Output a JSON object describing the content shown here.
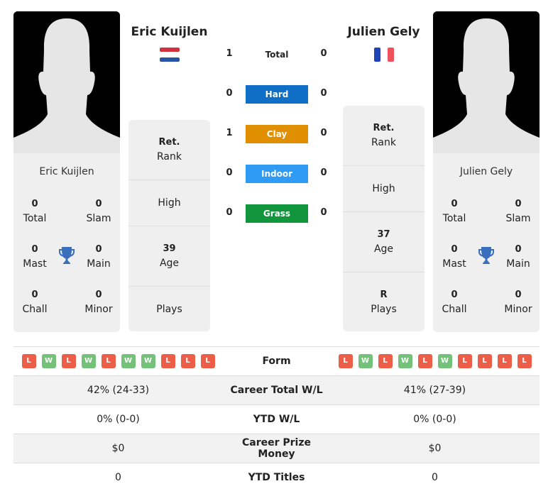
{
  "colors": {
    "hard": "#0f6fc6",
    "clay": "#e08f00",
    "indoor": "#2f9bf5",
    "grass": "#11963d",
    "loss": "#ec5e48",
    "win": "#74c27a",
    "trophy": "#3a6fbd"
  },
  "player1": {
    "name": "Eric Kuijlen",
    "flag": "netherlands-flag",
    "titles": {
      "total": "0",
      "total_label": "Total",
      "slam": "0",
      "slam_label": "Slam",
      "mast": "0",
      "mast_label": "Mast",
      "main": "0",
      "main_label": "Main",
      "chall": "0",
      "chall_label": "Chall",
      "minor": "0",
      "minor_label": "Minor"
    },
    "rank_value": "Ret.",
    "rank_label": "Rank",
    "high_label": "High",
    "age_value": "39",
    "age_label": "Age",
    "plays_value": "",
    "plays_label": "Plays",
    "form": [
      "L",
      "W",
      "L",
      "W",
      "L",
      "W",
      "W",
      "L",
      "L",
      "L"
    ],
    "career_wl": "42% (24-33)",
    "ytd_wl": "0% (0-0)",
    "prize": "$0",
    "ytd_titles": "0"
  },
  "player2": {
    "name": "Julien Gely",
    "flag": "france-flag",
    "titles": {
      "total": "0",
      "total_label": "Total",
      "slam": "0",
      "slam_label": "Slam",
      "mast": "0",
      "mast_label": "Mast",
      "main": "0",
      "main_label": "Main",
      "chall": "0",
      "chall_label": "Chall",
      "minor": "0",
      "minor_label": "Minor"
    },
    "rank_value": "Ret.",
    "rank_label": "Rank",
    "high_label": "High",
    "age_value": "37",
    "age_label": "Age",
    "plays_value": "R",
    "plays_label": "Plays",
    "form": [
      "L",
      "W",
      "L",
      "W",
      "L",
      "W",
      "L",
      "L",
      "L",
      "L"
    ],
    "career_wl": "41% (27-39)",
    "ytd_wl": "0% (0-0)",
    "prize": "$0",
    "ytd_titles": "0"
  },
  "h2h": {
    "total": {
      "label": "Total",
      "p1": "1",
      "p2": "0"
    },
    "hard": {
      "label": "Hard",
      "p1": "0",
      "p2": "0"
    },
    "clay": {
      "label": "Clay",
      "p1": "1",
      "p2": "0"
    },
    "indoor": {
      "label": "Indoor",
      "p1": "0",
      "p2": "0"
    },
    "grass": {
      "label": "Grass",
      "p1": "0",
      "p2": "0"
    }
  },
  "table": {
    "form_label": "Form",
    "career_label": "Career Total W/L",
    "ytd_label": "YTD W/L",
    "prize_label": "Career Prize Money",
    "titles_label": "YTD Titles"
  }
}
